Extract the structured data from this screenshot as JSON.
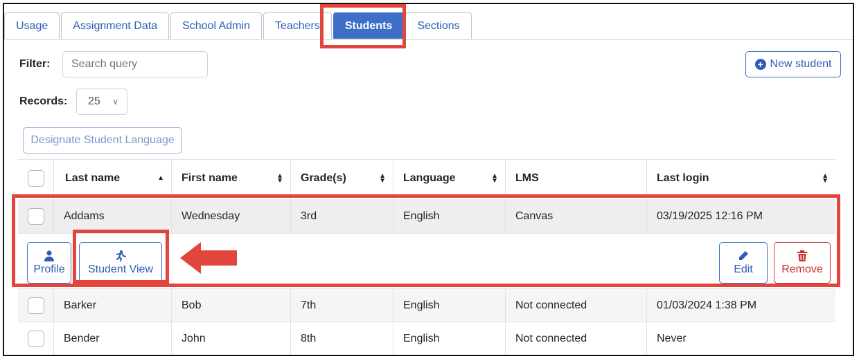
{
  "tabs": [
    {
      "label": "Usage"
    },
    {
      "label": "Assignment Data"
    },
    {
      "label": "School Admin"
    },
    {
      "label": "Teachers"
    },
    {
      "label": "Students"
    },
    {
      "label": "Sections"
    }
  ],
  "active_tab": "Students",
  "filter": {
    "label": "Filter:",
    "placeholder": "Search query"
  },
  "records": {
    "label": "Records:",
    "value": "25"
  },
  "new_student_label": "New student",
  "designate_label": "Designate Student Language",
  "table": {
    "columns": [
      "Last name",
      "First name",
      "Grade(s)",
      "Language",
      "LMS",
      "Last login"
    ],
    "rows": [
      [
        "Addams",
        "Wednesday",
        "3rd",
        "English",
        "Canvas",
        "03/19/2025 12:16 PM"
      ],
      [
        "Barker",
        "Bob",
        "7th",
        "English",
        "Not connected",
        "01/03/2024 1:38 PM"
      ],
      [
        "Bender",
        "John",
        "8th",
        "English",
        "Not connected",
        "Never"
      ]
    ]
  },
  "row_actions": {
    "profile": "Profile",
    "student_view": "Student View",
    "edit": "Edit",
    "remove": "Remove"
  },
  "colors": {
    "accent": "#3e6fc7",
    "highlight": "#e2453c",
    "danger": "#c9302c"
  }
}
